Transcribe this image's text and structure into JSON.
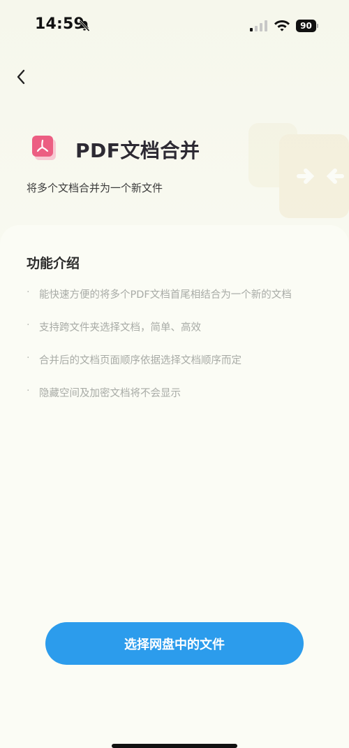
{
  "status_bar": {
    "time": "14:59",
    "battery": "90",
    "icons": [
      "bell-muted-icon",
      "signal-icon",
      "wifi-icon",
      "battery-icon"
    ]
  },
  "nav": {
    "back_icon": "chevron-left-icon"
  },
  "header": {
    "logo_icon": "pdf-icon",
    "title": "PDF文档合并",
    "subtitle": "将多个文档合并为一个新文件"
  },
  "features": {
    "title": "功能介绍",
    "items": [
      "能快速方便的将多个PDF文档首尾相结合为一个新的文档",
      "支持跨文件夹选择文档，简单、高效",
      "合并后的文档页面顺序依据选择文档顺序而定",
      "隐藏空间及加密文档将不会显示"
    ]
  },
  "action": {
    "button_label": "选择网盘中的文件"
  },
  "colors": {
    "accent": "#2c9cec",
    "pdf_logo": "#e9557a",
    "background": "#f8f9ef"
  }
}
